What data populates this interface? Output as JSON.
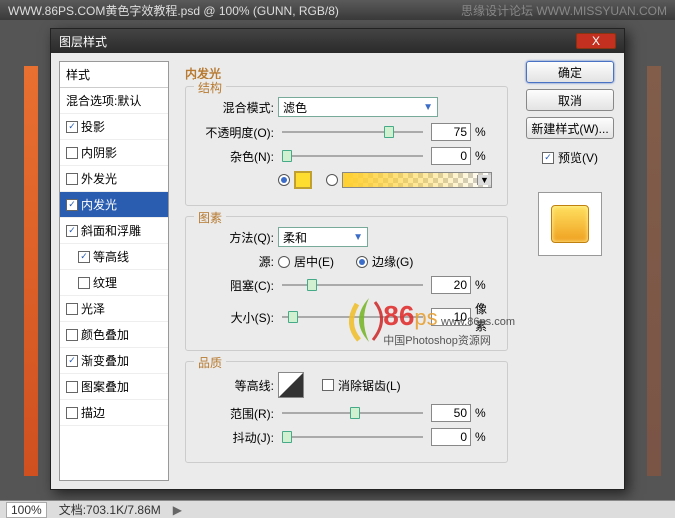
{
  "app": {
    "title_left": "WWW.86PS.COM黄色字效教程.psd @ 100% (GUNN, RGB/8)",
    "title_right": "思缘设计论坛  WWW.MISSYUAN.COM"
  },
  "dialog": {
    "title": "图层样式",
    "close": "X",
    "styles_header": "样式",
    "blend_defaults": "混合选项:默认",
    "items": [
      {
        "label": "投影",
        "checked": true
      },
      {
        "label": "内阴影",
        "checked": false
      },
      {
        "label": "外发光",
        "checked": false
      },
      {
        "label": "内发光",
        "checked": true,
        "selected": true
      },
      {
        "label": "斜面和浮雕",
        "checked": true
      },
      {
        "label": "等高线",
        "checked": true,
        "indent": true
      },
      {
        "label": "纹理",
        "checked": false,
        "indent": true
      },
      {
        "label": "光泽",
        "checked": false
      },
      {
        "label": "颜色叠加",
        "checked": false
      },
      {
        "label": "渐变叠加",
        "checked": true
      },
      {
        "label": "图案叠加",
        "checked": false
      },
      {
        "label": "描边",
        "checked": false
      }
    ],
    "panel_title": "内发光",
    "structure": {
      "legend": "结构",
      "blend_mode_label": "混合模式:",
      "blend_mode_value": "滤色",
      "opacity_label": "不透明度(O):",
      "opacity_value": "75",
      "opacity_unit": "%",
      "noise_label": "杂色(N):",
      "noise_value": "0",
      "noise_unit": "%"
    },
    "elements_group": {
      "legend": "图素",
      "technique_label": "方法(Q):",
      "technique_value": "柔和",
      "source_label": "源:",
      "source_center": "居中(E)",
      "source_edge": "边缘(G)",
      "choke_label": "阻塞(C):",
      "choke_value": "20",
      "choke_unit": "%",
      "size_label": "大小(S):",
      "size_value": "10",
      "size_unit": "像素"
    },
    "quality": {
      "legend": "品质",
      "contour_label": "等高线:",
      "antialias": "消除锯齿(L)",
      "range_label": "范围(R):",
      "range_value": "50",
      "range_unit": "%",
      "jitter_label": "抖动(J):",
      "jitter_value": "0",
      "jitter_unit": "%"
    },
    "buttons": {
      "ok": "确定",
      "cancel": "取消",
      "new_style": "新建样式(W)...",
      "preview": "预览(V)"
    }
  },
  "watermark": {
    "d86": "86",
    "ps": "ps",
    "url": "www.86ps.com",
    "sub": "中国Photoshop资源网"
  },
  "status": {
    "zoom": "100%",
    "doc": "文档:703.1K/7.86M"
  }
}
